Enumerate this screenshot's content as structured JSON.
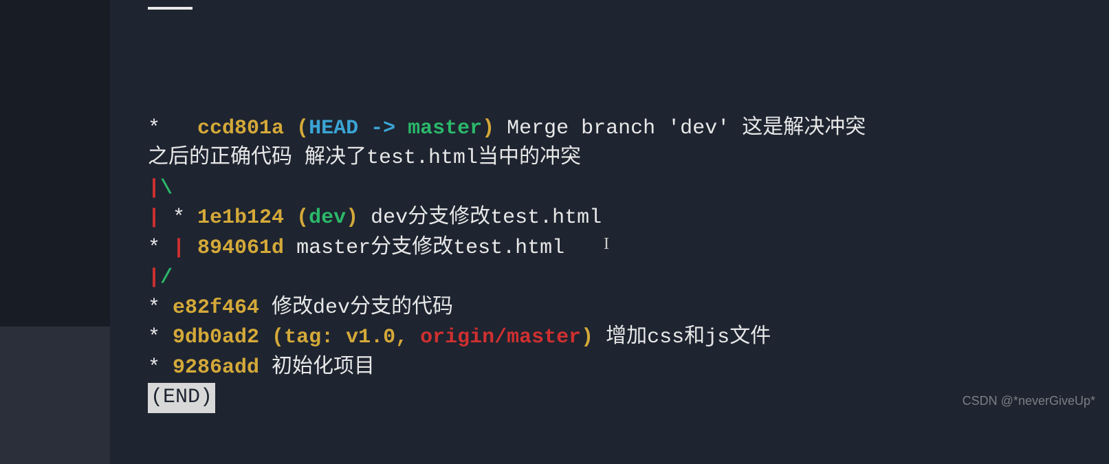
{
  "commits": [
    {
      "graph_prefix": "*   ",
      "hash": "ccd801a",
      "refs_open": " (",
      "head": "HEAD -> ",
      "branch": "master",
      "refs_close": ")",
      "message_part1": " Merge branch 'dev' 这是解决冲突",
      "message_wrap": "之后的正确代码 解决了test.html当中的冲突"
    },
    {
      "graph_line1_pipe": "|",
      "graph_line1_slash": "\\"
    },
    {
      "graph_pipe": "| ",
      "graph_star": "* ",
      "hash": "1e1b124",
      "refs_open": " (",
      "branch": "dev",
      "refs_close": ")",
      "message": " dev分支修改test.html"
    },
    {
      "graph_star": "* ",
      "graph_pipe": "| ",
      "hash": "894061d",
      "message": " master分支修改test.html"
    },
    {
      "graph_pipe": "|",
      "graph_slash": "/"
    },
    {
      "graph_star": "* ",
      "hash": "e82f464",
      "message": " 修改dev分支的代码"
    },
    {
      "graph_star": "* ",
      "hash": "9db0ad2",
      "refs_open": " (",
      "tag": "tag: v1.0",
      "comma": ", ",
      "remote": "origin/master",
      "refs_close": ")",
      "message": " 增加css和js文件"
    },
    {
      "graph_star": "* ",
      "hash": "9286add",
      "message": " 初始化项目"
    }
  ],
  "end_marker": "(END)",
  "watermark": "CSDN @*neverGiveUp*"
}
